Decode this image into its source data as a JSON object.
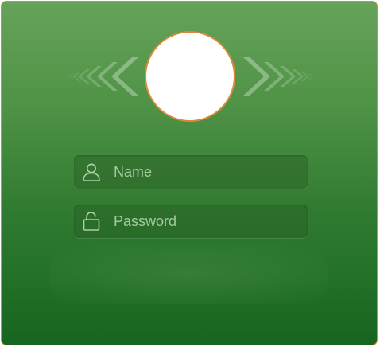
{
  "login": {
    "avatar_icon": "avatar-placeholder",
    "name_field": {
      "placeholder": "Name",
      "value": "",
      "icon": "user-icon"
    },
    "password_field": {
      "placeholder": "Password",
      "value": "",
      "icon": "unlock-icon"
    }
  },
  "colors": {
    "panel_top": "#66a25a",
    "panel_bottom": "#17661f",
    "border_accent": "#d98a3a",
    "avatar_fill": "#ffffff"
  }
}
